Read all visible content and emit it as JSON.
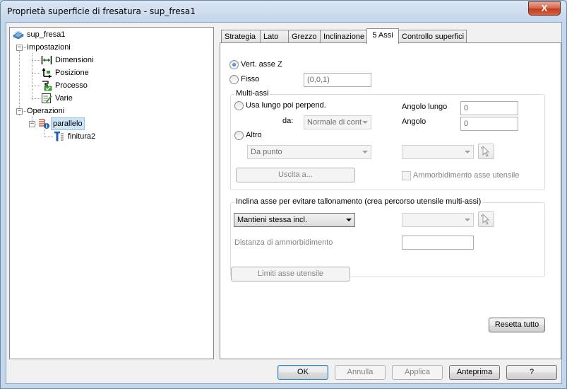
{
  "window": {
    "title": "Proprietà superficie di fresatura - sup_fresa1",
    "close_label": "X"
  },
  "tree": {
    "root": "sup_fresa1",
    "impostazioni": "Impostazioni",
    "dimensioni": "Dimensioni",
    "posizione": "Posizione",
    "processo": "Processo",
    "varie": "Varie",
    "operazioni": "Operazioni",
    "parallelo": "parallelo",
    "finitura2": "finitura2",
    "expand_minus": "−"
  },
  "tabs": [
    {
      "label": "Strategia"
    },
    {
      "label": "Lato"
    },
    {
      "label": "Grezzo"
    },
    {
      "label": "Inclinazione"
    },
    {
      "label": "5 Assi"
    },
    {
      "label": "Controllo superfici"
    }
  ],
  "panel": {
    "vert_asse_z": "Vert. asse Z",
    "fisso": "Fisso",
    "fisso_value": "(0,0,1)",
    "multi_assi": {
      "title": "Multi-assi",
      "usa_lungo": "Usa lungo poi perpend.",
      "da_label": "da:",
      "da_value": "Normale di cont",
      "angolo_lungo_label": "Angolo lungo",
      "angolo_lungo_value": "0",
      "angolo_label": "Angolo",
      "angolo_value": "0",
      "altro": "Altro",
      "da_punto": "Da punto",
      "altro_combo2": "",
      "uscita": "Uscita a...",
      "ammorbidimento": "Ammorbidimento asse utensile"
    },
    "inclina": {
      "title": "Inclina asse per evitare tallonamento (crea percorso utensile multi-assi)",
      "combo_value": "Mantieni stessa incl.",
      "combo2_value": "",
      "distanza_label": "Distanza di ammorbidimento",
      "distanza_value": ""
    },
    "limiti": "Limiti asse utensile",
    "resetta": "Resetta tutto"
  },
  "footer": {
    "ok": "OK",
    "annulla": "Annulla",
    "applica": "Applica",
    "anteprima": "Anteprima",
    "help": "?"
  },
  "colors": {
    "selection": "#cde4f7",
    "accent": "#3c7fb1"
  }
}
